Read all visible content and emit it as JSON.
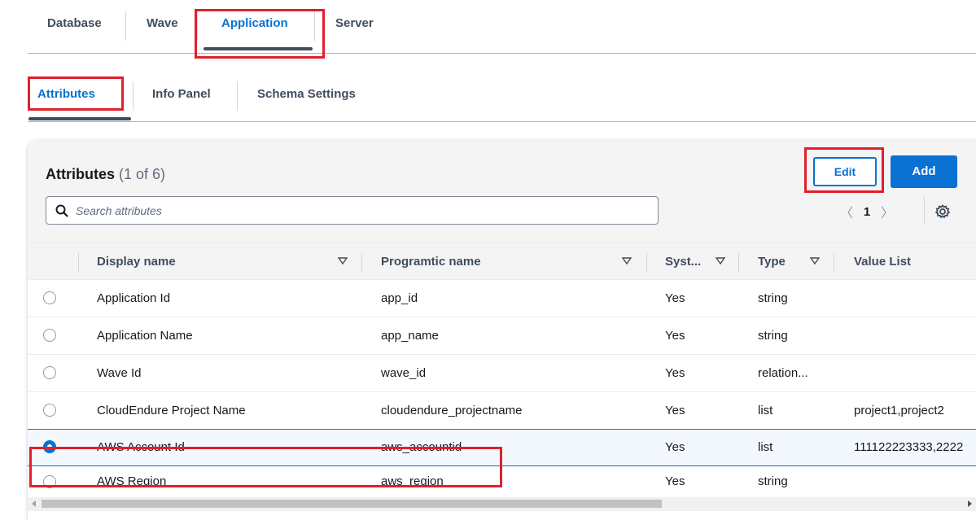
{
  "top_tabs": {
    "items": [
      {
        "label": "Database"
      },
      {
        "label": "Wave"
      },
      {
        "label": "Application"
      },
      {
        "label": "Server"
      }
    ],
    "active": "Application"
  },
  "sub_tabs": {
    "items": [
      {
        "label": "Attributes"
      },
      {
        "label": "Info Panel"
      },
      {
        "label": "Schema Settings"
      }
    ],
    "active": "Attributes"
  },
  "panel": {
    "title": "Attributes",
    "count": "(1 of 6)",
    "edit_label": "Edit",
    "add_label": "Add",
    "search_placeholder": "Search attributes",
    "page": "1"
  },
  "table": {
    "columns": [
      "Display name",
      "Programtic name",
      "Syst...",
      "Type",
      "Value List"
    ],
    "rows": [
      {
        "display": "Application Id",
        "prog": "app_id",
        "system": "Yes",
        "type": "string",
        "values": ""
      },
      {
        "display": "Application Name",
        "prog": "app_name",
        "system": "Yes",
        "type": "string",
        "values": ""
      },
      {
        "display": "Wave Id",
        "prog": "wave_id",
        "system": "Yes",
        "type": "relation...",
        "values": ""
      },
      {
        "display": "CloudEndure Project Name",
        "prog": "cloudendure_projectname",
        "system": "Yes",
        "type": "list",
        "values": "project1,project2"
      },
      {
        "display": "AWS Account Id",
        "prog": "aws_accountid",
        "system": "Yes",
        "type": "list",
        "values": "111122223333,2222"
      },
      {
        "display": "AWS Region",
        "prog": "aws_region",
        "system": "Yes",
        "type": "string",
        "values": ""
      }
    ],
    "selected_row": 4
  },
  "colors": {
    "accent": "#0972d3",
    "annotation": "#e0202c"
  }
}
